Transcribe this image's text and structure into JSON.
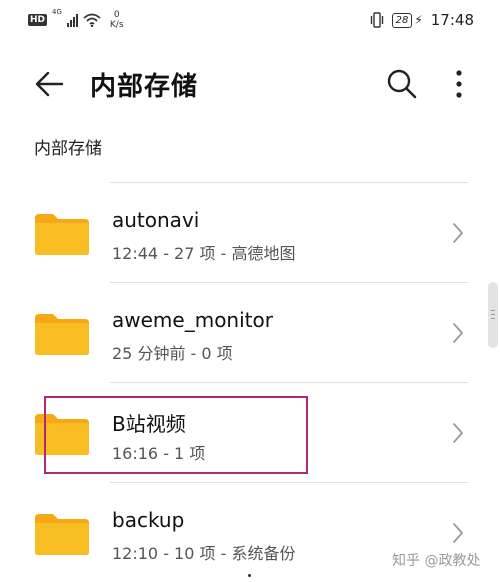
{
  "status_bar": {
    "hd": "HD",
    "network": "4G",
    "speed_value": "0",
    "speed_unit": "K/s",
    "battery": "28",
    "time": "17:48"
  },
  "header": {
    "title": "内部存储",
    "icons": [
      "back-arrow-icon",
      "search-icon",
      "more-vertical-icon"
    ]
  },
  "breadcrumb": "内部存储",
  "folders": [
    {
      "name": "autonavi",
      "meta": "12:44 - 27 项 - 高德地图"
    },
    {
      "name": "aweme_monitor",
      "meta": "25 分钟前 - 0 项"
    },
    {
      "name": "B站视频",
      "meta": "16:16 - 1 项"
    },
    {
      "name": "backup",
      "meta": "12:10 - 10 项 - 系统备份"
    }
  ],
  "watermark": "知乎 @政教处",
  "colors": {
    "folder": "#f9b91e",
    "folder_tab": "#f7a816",
    "highlight": "#b0287a"
  }
}
